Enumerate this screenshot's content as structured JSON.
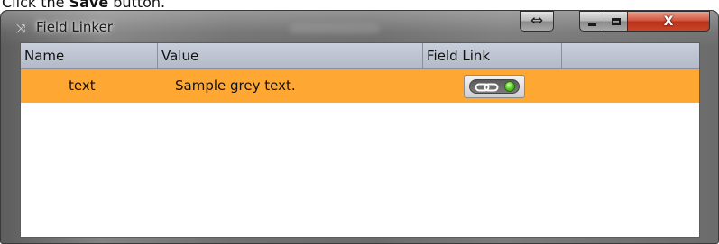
{
  "instruction": {
    "prefix": "Click the ",
    "emphasis": "Save",
    "suffix": " button."
  },
  "window": {
    "title": "Field Linker",
    "controls": {
      "resize_glyph": "⇔",
      "close_glyph": "X"
    }
  },
  "grid": {
    "columns": [
      "Name",
      "Value",
      "Field Link",
      ""
    ],
    "rows": [
      {
        "name": "text",
        "value": "Sample grey text.",
        "field_link_status": "linked"
      }
    ]
  },
  "colors": {
    "selected_row": "#ffa733",
    "link_status": "#5ed12a",
    "header": "#b8bfcc"
  },
  "icons": {
    "title": "field-linker-app-icon",
    "field_link": "chain-link-icon",
    "status": "green-status-dot-icon"
  }
}
